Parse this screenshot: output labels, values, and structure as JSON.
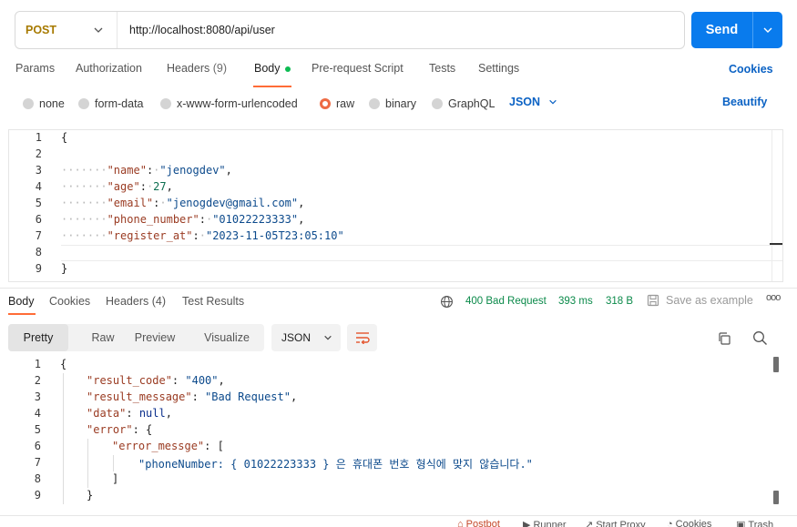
{
  "request": {
    "method": "POST",
    "url": "http://localhost:8080/api/user",
    "send_label": "Send"
  },
  "request_tabs": [
    {
      "label": "Params"
    },
    {
      "label": "Authorization"
    },
    {
      "label": "Headers",
      "count": "(9)"
    },
    {
      "label": "Body"
    },
    {
      "label": "Pre-request Script"
    },
    {
      "label": "Tests"
    },
    {
      "label": "Settings"
    }
  ],
  "cookies_label": "Cookies",
  "body_types": [
    "none",
    "form-data",
    "x-www-form-urlencoded",
    "raw",
    "binary",
    "GraphQL"
  ],
  "selected_body_type": "raw",
  "body_format": "JSON",
  "beautify_label": "Beautify",
  "request_body": {
    "line_numbers": [
      "1",
      "2",
      "3",
      "4",
      "5",
      "6",
      "7",
      "8",
      "9"
    ],
    "open_brace": "{",
    "close_brace": "}",
    "fields": [
      {
        "key": "\"name\"",
        "value": "\"jenogdev\"",
        "type": "str",
        "comma": ","
      },
      {
        "key": "\"age\"",
        "value": "27",
        "type": "num",
        "comma": ","
      },
      {
        "key": "\"email\"",
        "value": "\"jenogdev@gmail.com\"",
        "type": "str",
        "comma": ","
      },
      {
        "key": "\"phone_number\"",
        "value": "\"01022223333\"",
        "type": "str",
        "comma": ","
      },
      {
        "key": "\"register_at\"",
        "value": "\"2023-11-05T23:05:10\"",
        "type": "str",
        "comma": ""
      }
    ]
  },
  "response_tabs": [
    {
      "label": "Body"
    },
    {
      "label": "Cookies"
    },
    {
      "label": "Headers",
      "count": "(4)"
    },
    {
      "label": "Test Results"
    }
  ],
  "response_status": {
    "status": "400 Bad Request",
    "time": "393 ms",
    "size": "318 B"
  },
  "save_example_label": "Save as example",
  "more_label": "ooo",
  "view_modes": [
    "Pretty",
    "Raw",
    "Preview",
    "Visualize"
  ],
  "selected_view_mode": "Pretty",
  "response_format": "JSON",
  "response_body": {
    "line_numbers": [
      "1",
      "2",
      "3",
      "4",
      "5",
      "6",
      "7",
      "8",
      "9"
    ],
    "line1": "{",
    "result_code_key": "\"result_code\"",
    "result_code_value": "\"400\"",
    "result_message_key": "\"result_message\"",
    "result_message_value": "\"Bad Request\"",
    "data_key": "\"data\"",
    "data_value": "null",
    "error_key": "\"error\"",
    "error_open": "{",
    "error_messge_key": "\"error_messge\"",
    "array_open": "[",
    "error_item": "\"phoneNumber: { 01022223333 } 은 휴대폰 번호 형식에 맞지 않습니다.\"",
    "array_close": "]",
    "error_close": "}"
  },
  "footer": [
    "Postbot",
    "Runner",
    "Start Proxy",
    "Cookies",
    "Trash"
  ],
  "colors": {
    "accent": "#ff6c37",
    "send": "#097bed",
    "method": "#a77a00",
    "link": "#0b62c4",
    "status_ok": "#0b8a4a"
  }
}
